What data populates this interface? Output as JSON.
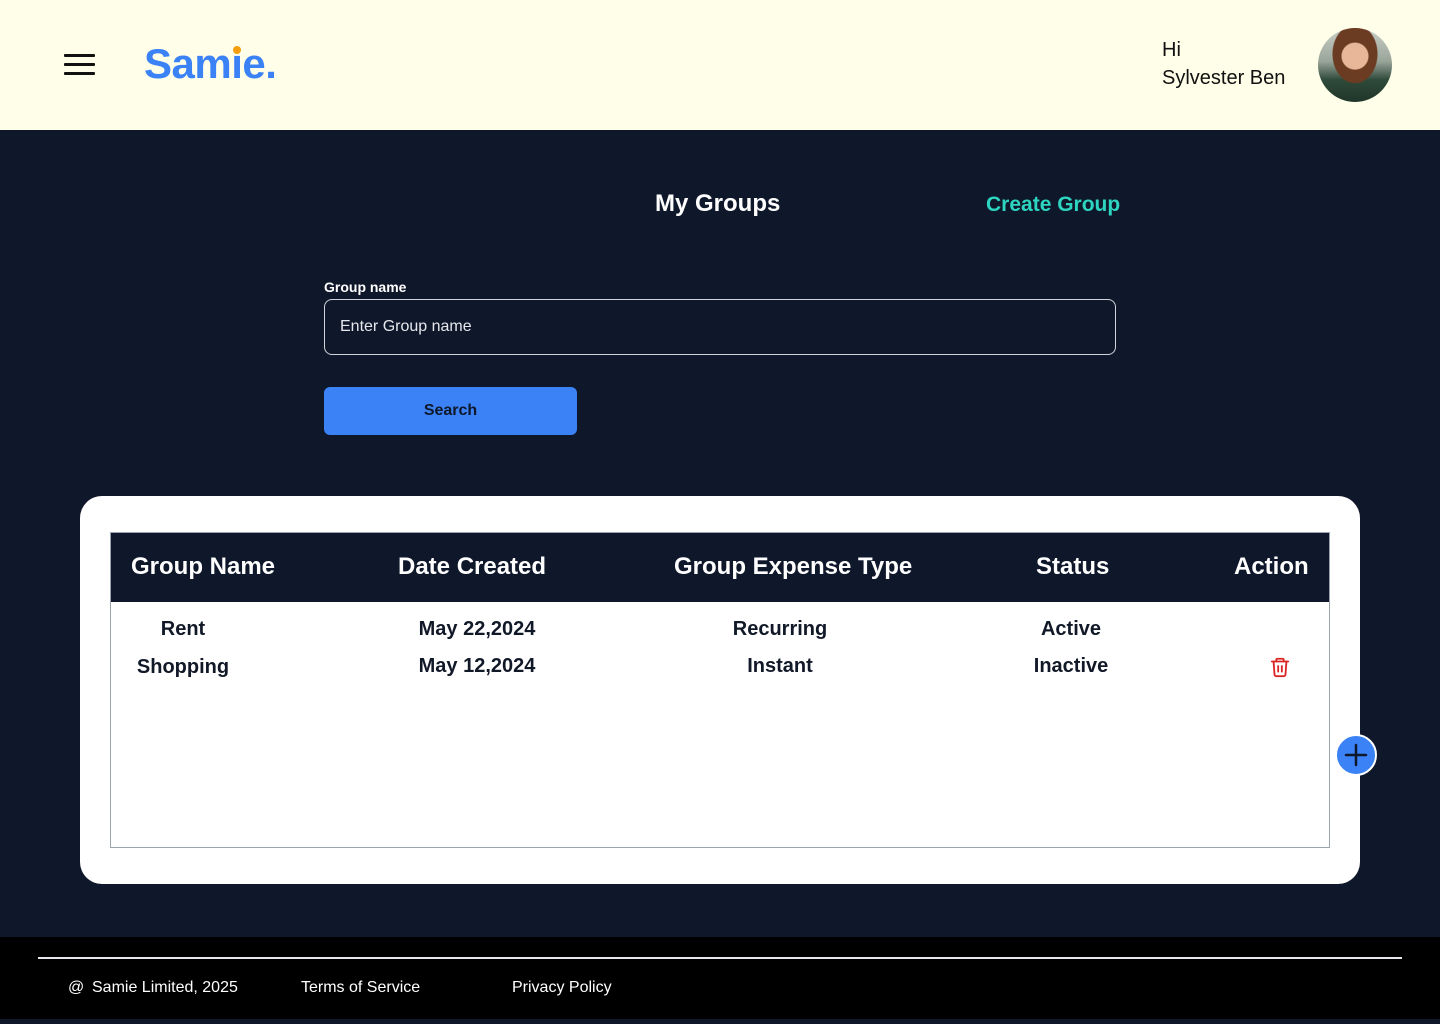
{
  "header": {
    "logo_text": "Samie.",
    "greeting_hi": "Hi",
    "user_name": "Sylvester Ben"
  },
  "main": {
    "title": "My Groups",
    "create_group_label": "Create Group",
    "search": {
      "label": "Group name",
      "placeholder": "Enter Group name",
      "button_label": "Search"
    }
  },
  "table": {
    "columns": [
      "Group Name",
      "Date Created",
      "Group Expense Type",
      "Status",
      "Action"
    ],
    "rows": [
      {
        "name": "Rent",
        "date": "May 22,2024",
        "type": "Recurring",
        "status": "Active",
        "action": ""
      },
      {
        "name": "Shopping",
        "date": "May 12,2024",
        "type": "Instant",
        "status": "Inactive",
        "action": "delete-icon"
      }
    ]
  },
  "footer": {
    "copyright_symbol": "@",
    "copyright": "Samie Limited, 2025",
    "terms": "Terms of Service",
    "privacy": "Privacy Policy"
  },
  "colors": {
    "accent": "#3b82f6",
    "teal": "#2dd4bf",
    "danger": "#dc2626",
    "page_bg": "#0f172a",
    "header_bg": "#fefee9"
  }
}
